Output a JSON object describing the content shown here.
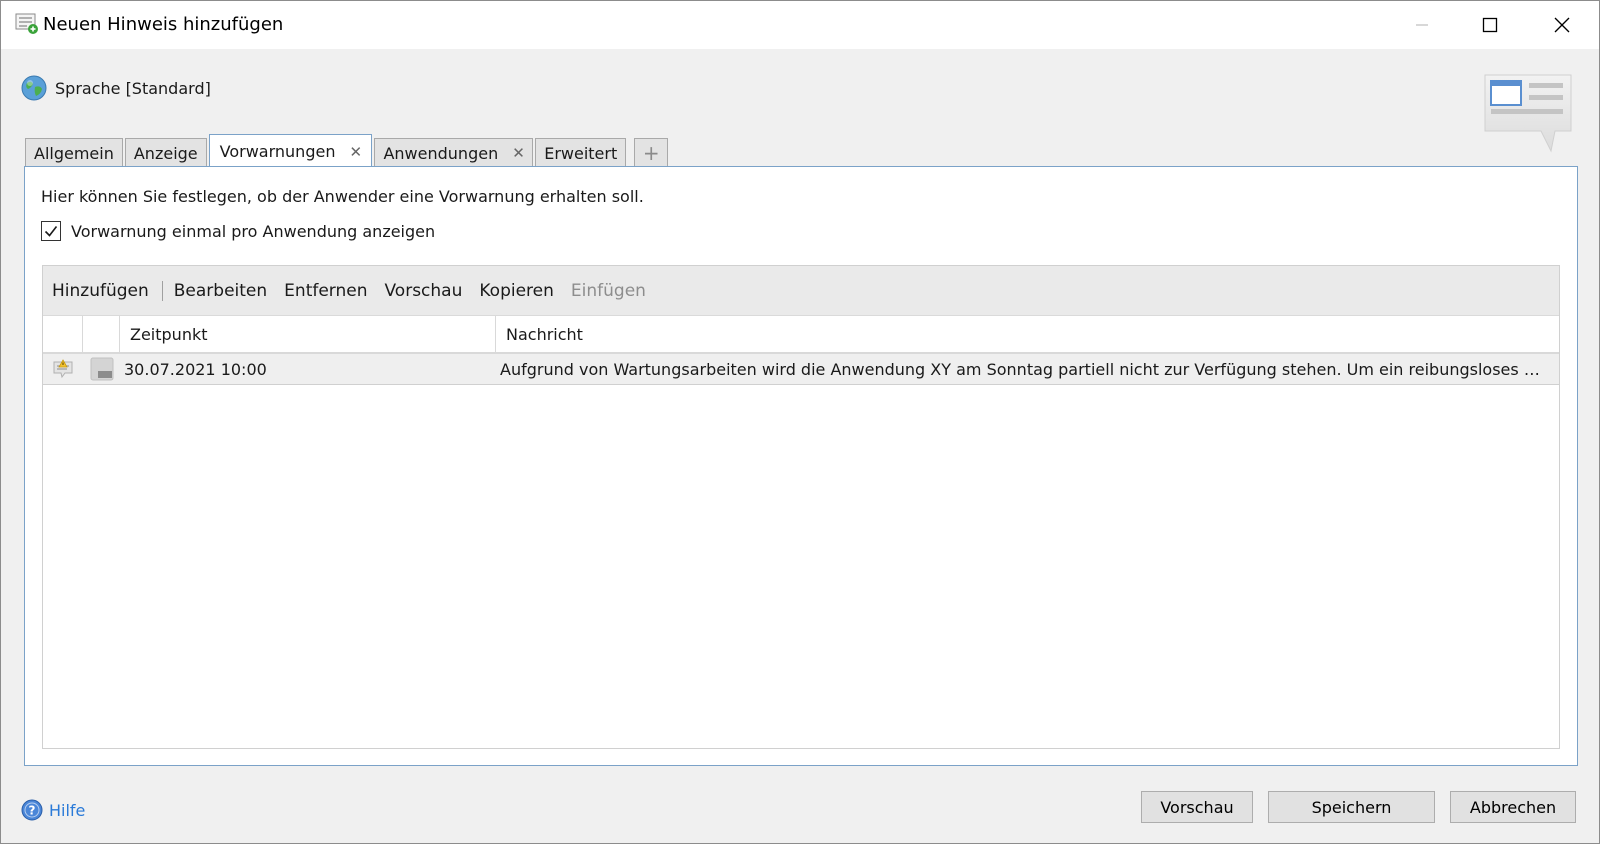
{
  "window": {
    "title": "Neuen Hinweis hinzufügen"
  },
  "language": {
    "label": "Sprache [Standard]"
  },
  "tabs": [
    {
      "label": "Allgemein",
      "active": false,
      "closable": false
    },
    {
      "label": "Anzeige",
      "active": false,
      "closable": false
    },
    {
      "label": "Vorwarnungen",
      "active": true,
      "closable": true,
      "close_glyph": "✕"
    },
    {
      "label": "Anwendungen",
      "active": false,
      "closable": true,
      "close_glyph": "✕"
    },
    {
      "label": "Erweitert",
      "active": false,
      "closable": false
    },
    {
      "label": "+",
      "add": true
    }
  ],
  "panel": {
    "info_text": "Hier können Sie festlegen, ob der Anwender eine Vorwarnung erhalten soll.",
    "checkbox_label": "Vorwarnung einmal pro Anwendung anzeigen",
    "checkbox_checked": true
  },
  "toolbar": {
    "add": "Hinzufügen",
    "edit": "Bearbeiten",
    "remove": "Entfernen",
    "preview": "Vorschau",
    "copy": "Kopieren",
    "paste": "Einfügen"
  },
  "grid": {
    "columns": [
      "",
      "",
      "Zeitpunkt",
      "Nachricht"
    ],
    "rows": [
      {
        "time": "30.07.2021 10:00",
        "message": "Aufgrund von Wartungsarbeiten wird die Anwendung XY am Sonntag partiell nicht zur Verfügung stehen. Um ein reibungsloses U..."
      }
    ]
  },
  "footer": {
    "help": "Hilfe",
    "preview_button": "Vorschau",
    "save_button": "Speichern",
    "cancel_button": "Abbrechen"
  },
  "colors": {
    "accent_border": "#7ba2c8",
    "link": "#2a7ad8",
    "toolbar_bg": "#eaeaea"
  },
  "icons": {
    "title": "note-add-icon",
    "language": "globe-icon",
    "decoration": "speech-bubble-icon",
    "help": "help-icon",
    "row_type": "warning-message-icon",
    "row_state": "grey-block-icon"
  }
}
